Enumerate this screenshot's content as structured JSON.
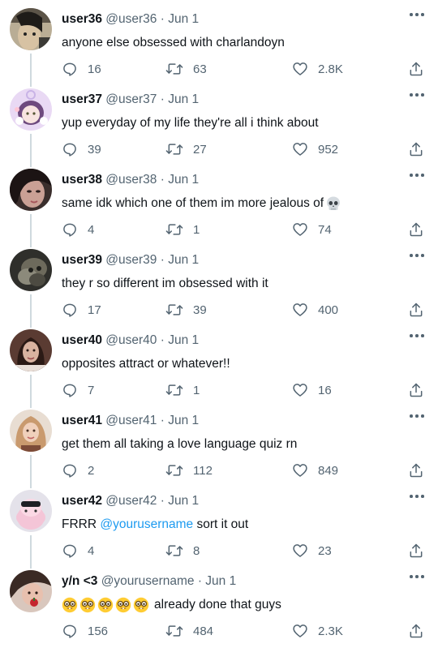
{
  "tweets": [
    {
      "name": "user36",
      "handle": "@user36",
      "date": "Jun 1",
      "text": "anyone else obsessed with charlandoyn",
      "replies": "16",
      "retweets": "63",
      "likes": "2.8K"
    },
    {
      "name": "user37",
      "handle": "@user37",
      "date": "Jun 1",
      "text": "yup everyday of my life they're all i think about",
      "replies": "39",
      "retweets": "27",
      "likes": "952"
    },
    {
      "name": "user38",
      "handle": "@user38",
      "date": "Jun 1",
      "text": "same idk which one of them im more jealous of",
      "emoji": "skull",
      "replies": "4",
      "retweets": "1",
      "likes": "74"
    },
    {
      "name": "user39",
      "handle": "@user39",
      "date": "Jun 1",
      "text": "they r so different im obsessed with it",
      "replies": "17",
      "retweets": "39",
      "likes": "400"
    },
    {
      "name": "user40",
      "handle": "@user40",
      "date": "Jun 1",
      "text": "opposites attract or whatever!!",
      "replies": "7",
      "retweets": "1",
      "likes": "16"
    },
    {
      "name": "user41",
      "handle": "@user41",
      "date": "Jun 1",
      "text": "get them all taking a love language quiz rn",
      "replies": "2",
      "retweets": "112",
      "likes": "849"
    },
    {
      "name": "user42",
      "handle": "@user42",
      "date": "Jun 1",
      "text_prefix": "FRRR ",
      "mention": "@yourusername",
      "text_suffix": " sort it out",
      "replies": "4",
      "retweets": "8",
      "likes": "23"
    },
    {
      "name": "y/n <3",
      "handle": "@yourusername",
      "date": "Jun 1",
      "emoji_prefix": "nerd-face x5",
      "text": "already done that guys",
      "replies": "156",
      "retweets": "484",
      "likes": "2.3K"
    }
  ],
  "separator": "·",
  "colors": {
    "text": "#0f1419",
    "muted": "#536471",
    "link": "#1d9bf0",
    "line": "#cfd9de"
  }
}
